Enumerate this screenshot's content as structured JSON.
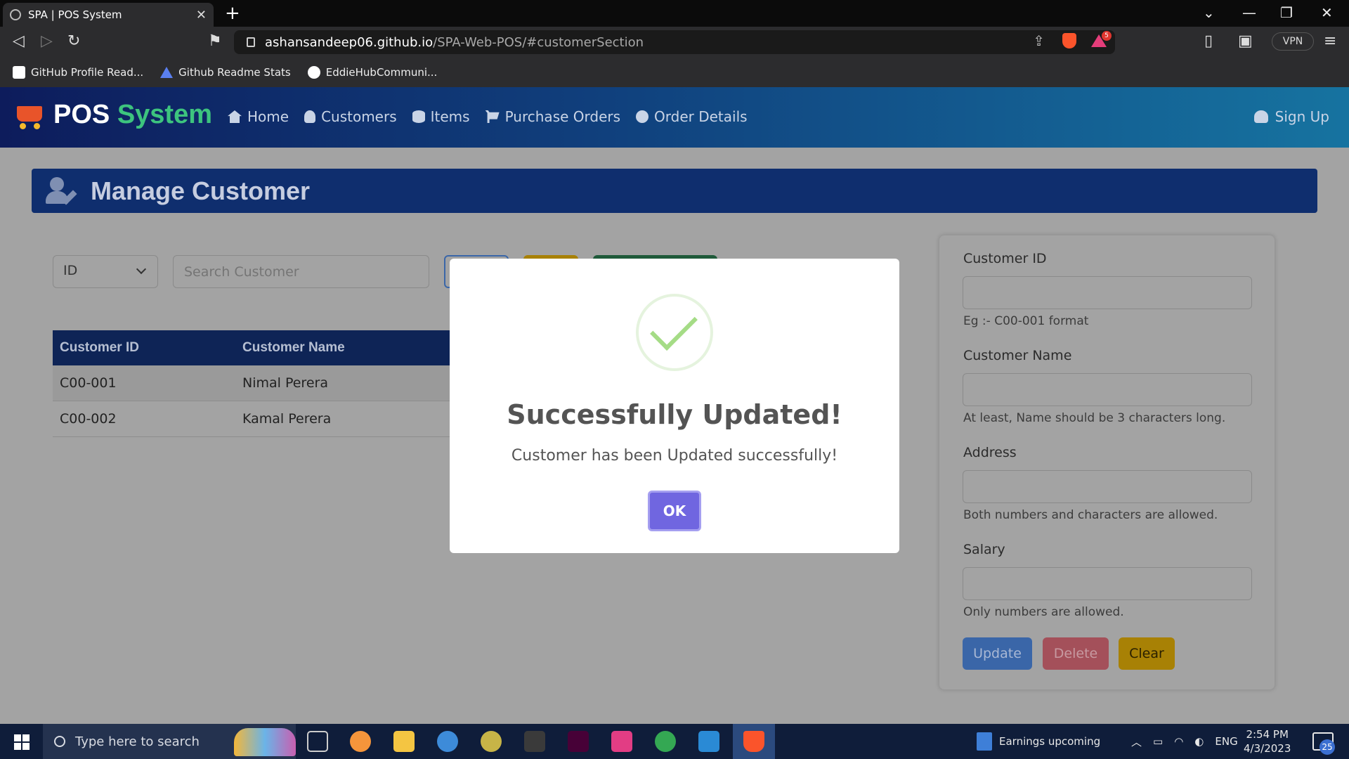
{
  "browser": {
    "tab_title": "SPA | POS System",
    "url_host": "ashansandeep06.github.io",
    "url_path": "/SPA-Web-POS/#customerSection",
    "vpn_label": "VPN",
    "bat_badge": "5",
    "bookmarks": [
      "GitHub Profile Read...",
      "Github Readme Stats",
      "EddieHubCommuni..."
    ]
  },
  "app": {
    "brand_main": "POS",
    "brand_accent": "System",
    "nav": [
      "Home",
      "Customers",
      "Items",
      "Purchase Orders",
      "Order Details"
    ],
    "signup": "Sign Up",
    "section_title": "Manage Customer",
    "search": {
      "select_value": "ID",
      "placeholder": "Search Customer"
    },
    "table": {
      "headers": [
        "Customer ID",
        "Customer Name"
      ],
      "rows": [
        [
          "C00-001",
          "Nimal Perera"
        ],
        [
          "C00-002",
          "Kamal Perera"
        ]
      ]
    },
    "form": {
      "id_label": "Customer ID",
      "id_hint": "Eg :- C00-001 format",
      "name_label": "Customer Name",
      "name_hint": "At least, Name should be 3 characters long.",
      "address_label": "Address",
      "address_hint": "Both numbers and characters are allowed.",
      "salary_label": "Salary",
      "salary_hint": "Only numbers are allowed.",
      "update_label": "Update",
      "delete_label": "Delete",
      "clear_label": "Clear"
    }
  },
  "modal": {
    "title": "Successfully Updated!",
    "message": "Customer has been Updated successfully!",
    "ok_label": "OK"
  },
  "taskbar": {
    "search_placeholder": "Type here to search",
    "weather": "Earnings upcoming",
    "lang": "ENG",
    "time": "2:54 PM",
    "date": "4/3/2023",
    "notifications": "25"
  }
}
